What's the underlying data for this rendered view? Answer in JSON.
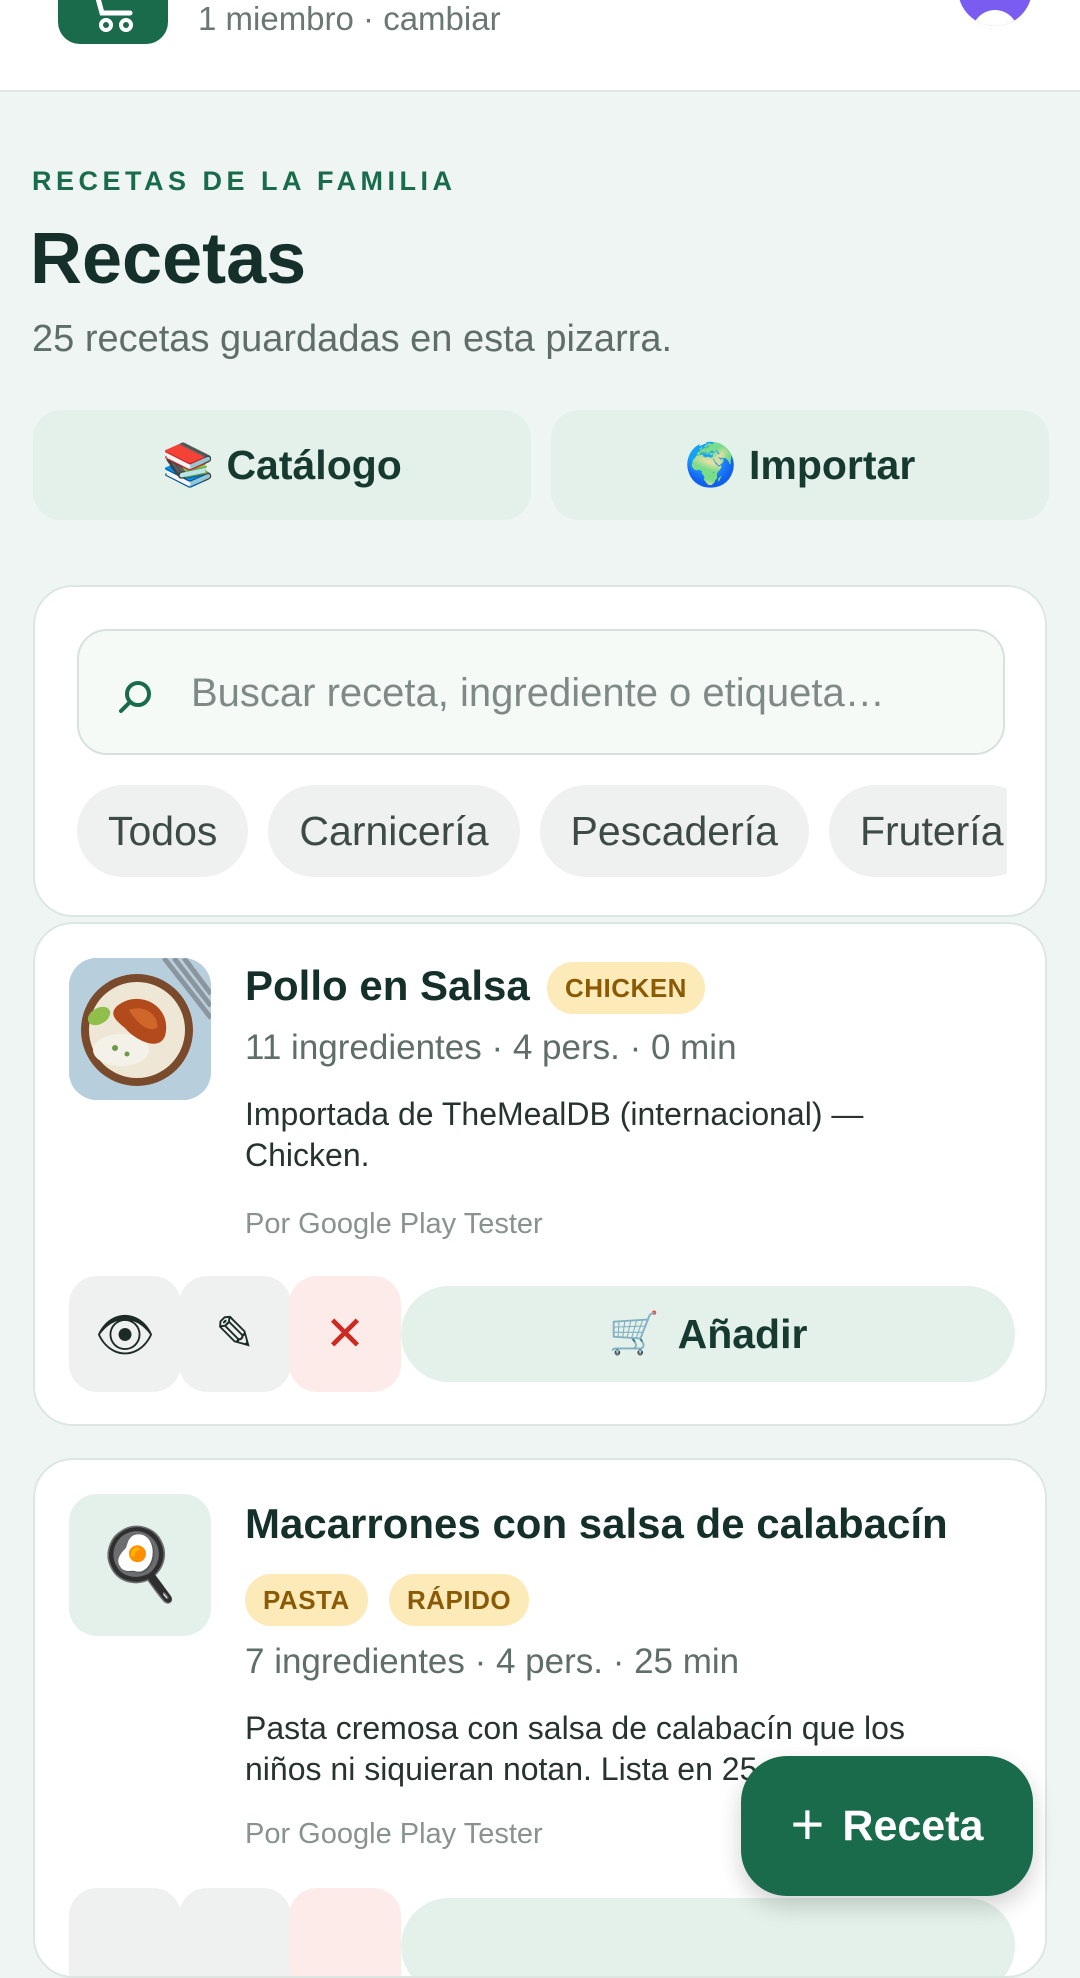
{
  "header": {
    "members_text": "1 miembro · cambiar"
  },
  "page": {
    "eyebrow": "RECETAS DE LA FAMILIA",
    "title": "Recetas",
    "subtitle": "25 recetas guardadas en esta pizarra."
  },
  "top_actions": {
    "catalog": {
      "icon": "📚",
      "label": "Catálogo"
    },
    "import": {
      "icon": "🌍",
      "label": "Importar"
    }
  },
  "search": {
    "placeholder": "Buscar receta, ingrediente o etiqueta…",
    "value": ""
  },
  "filters": [
    "Todos",
    "Carnicería",
    "Pescadería",
    "Frutería"
  ],
  "recipes": [
    {
      "title": "Pollo en Salsa",
      "tags": [
        "CHICKEN"
      ],
      "meta": "11 ingredientes · 4 pers. · 0 min",
      "description": "Importada de TheMealDB (internacional) — Chicken.",
      "author": "Por Google Play Tester",
      "actions": {
        "view": "👁",
        "edit": "✎",
        "delete": "✕",
        "add_icon": "🛒",
        "add_label": "Añadir"
      }
    },
    {
      "title": "Macarrones con salsa de calabacín",
      "icon": "🍳",
      "tags": [
        "PASTA",
        "RÁPIDO"
      ],
      "meta": "7 ingredientes · 4 pers. · 25 min",
      "description": "Pasta cremosa con salsa de calabacín que los niños ni siquieran notan. Lista en 25 minutos.",
      "author": "Por Google Play Tester"
    }
  ],
  "fab": {
    "icon": "+",
    "label": "Receta"
  },
  "colors": {
    "brand_green": "#1a6b4b",
    "background": "#eef5f2",
    "tag_yellow": "#fcebb8",
    "delete_red": "#cc2b22"
  }
}
